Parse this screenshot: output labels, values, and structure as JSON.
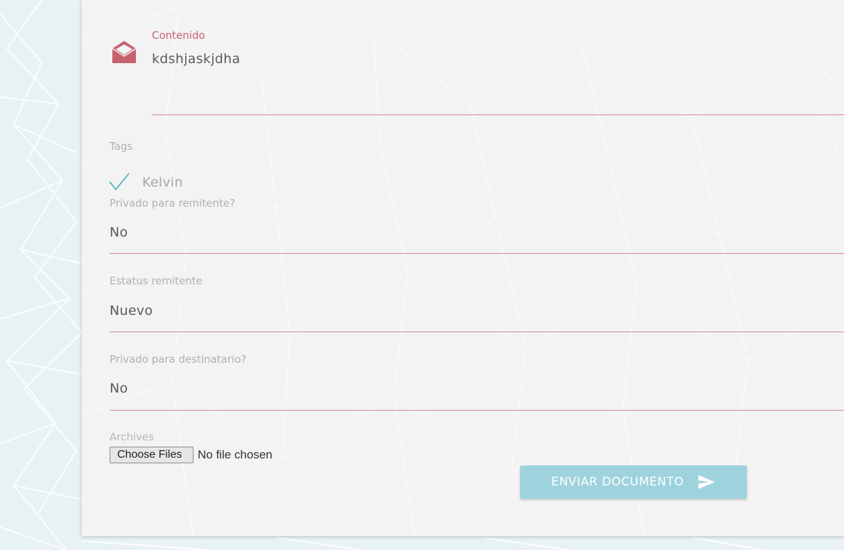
{
  "contenido": {
    "label": "Contenido",
    "value": "kdshjaskjdha",
    "icon": "envelope-open-icon"
  },
  "tags": {
    "label": "Tags",
    "items": [
      {
        "label": "Kelvin",
        "checked": true,
        "icon": "check-icon"
      }
    ]
  },
  "fields": [
    {
      "label": "Privado para remitente?",
      "value": "No"
    },
    {
      "label": "Estatus remitente",
      "value": "Nuevo"
    },
    {
      "label": "Privado para destinatario?",
      "value": "No"
    }
  ],
  "archives": {
    "label": "Archives",
    "button_label": "Choose Files",
    "status": "No file chosen"
  },
  "send_button": {
    "label": "ENVIAR DOCUMENTO",
    "icon": "send-icon"
  },
  "colors": {
    "accent": "#c8616f",
    "underline": "#d7838e",
    "button": "#9ed3de",
    "check": "#5fb8be",
    "card": "#f3f3f4",
    "page_background": "#e8f1f4"
  }
}
